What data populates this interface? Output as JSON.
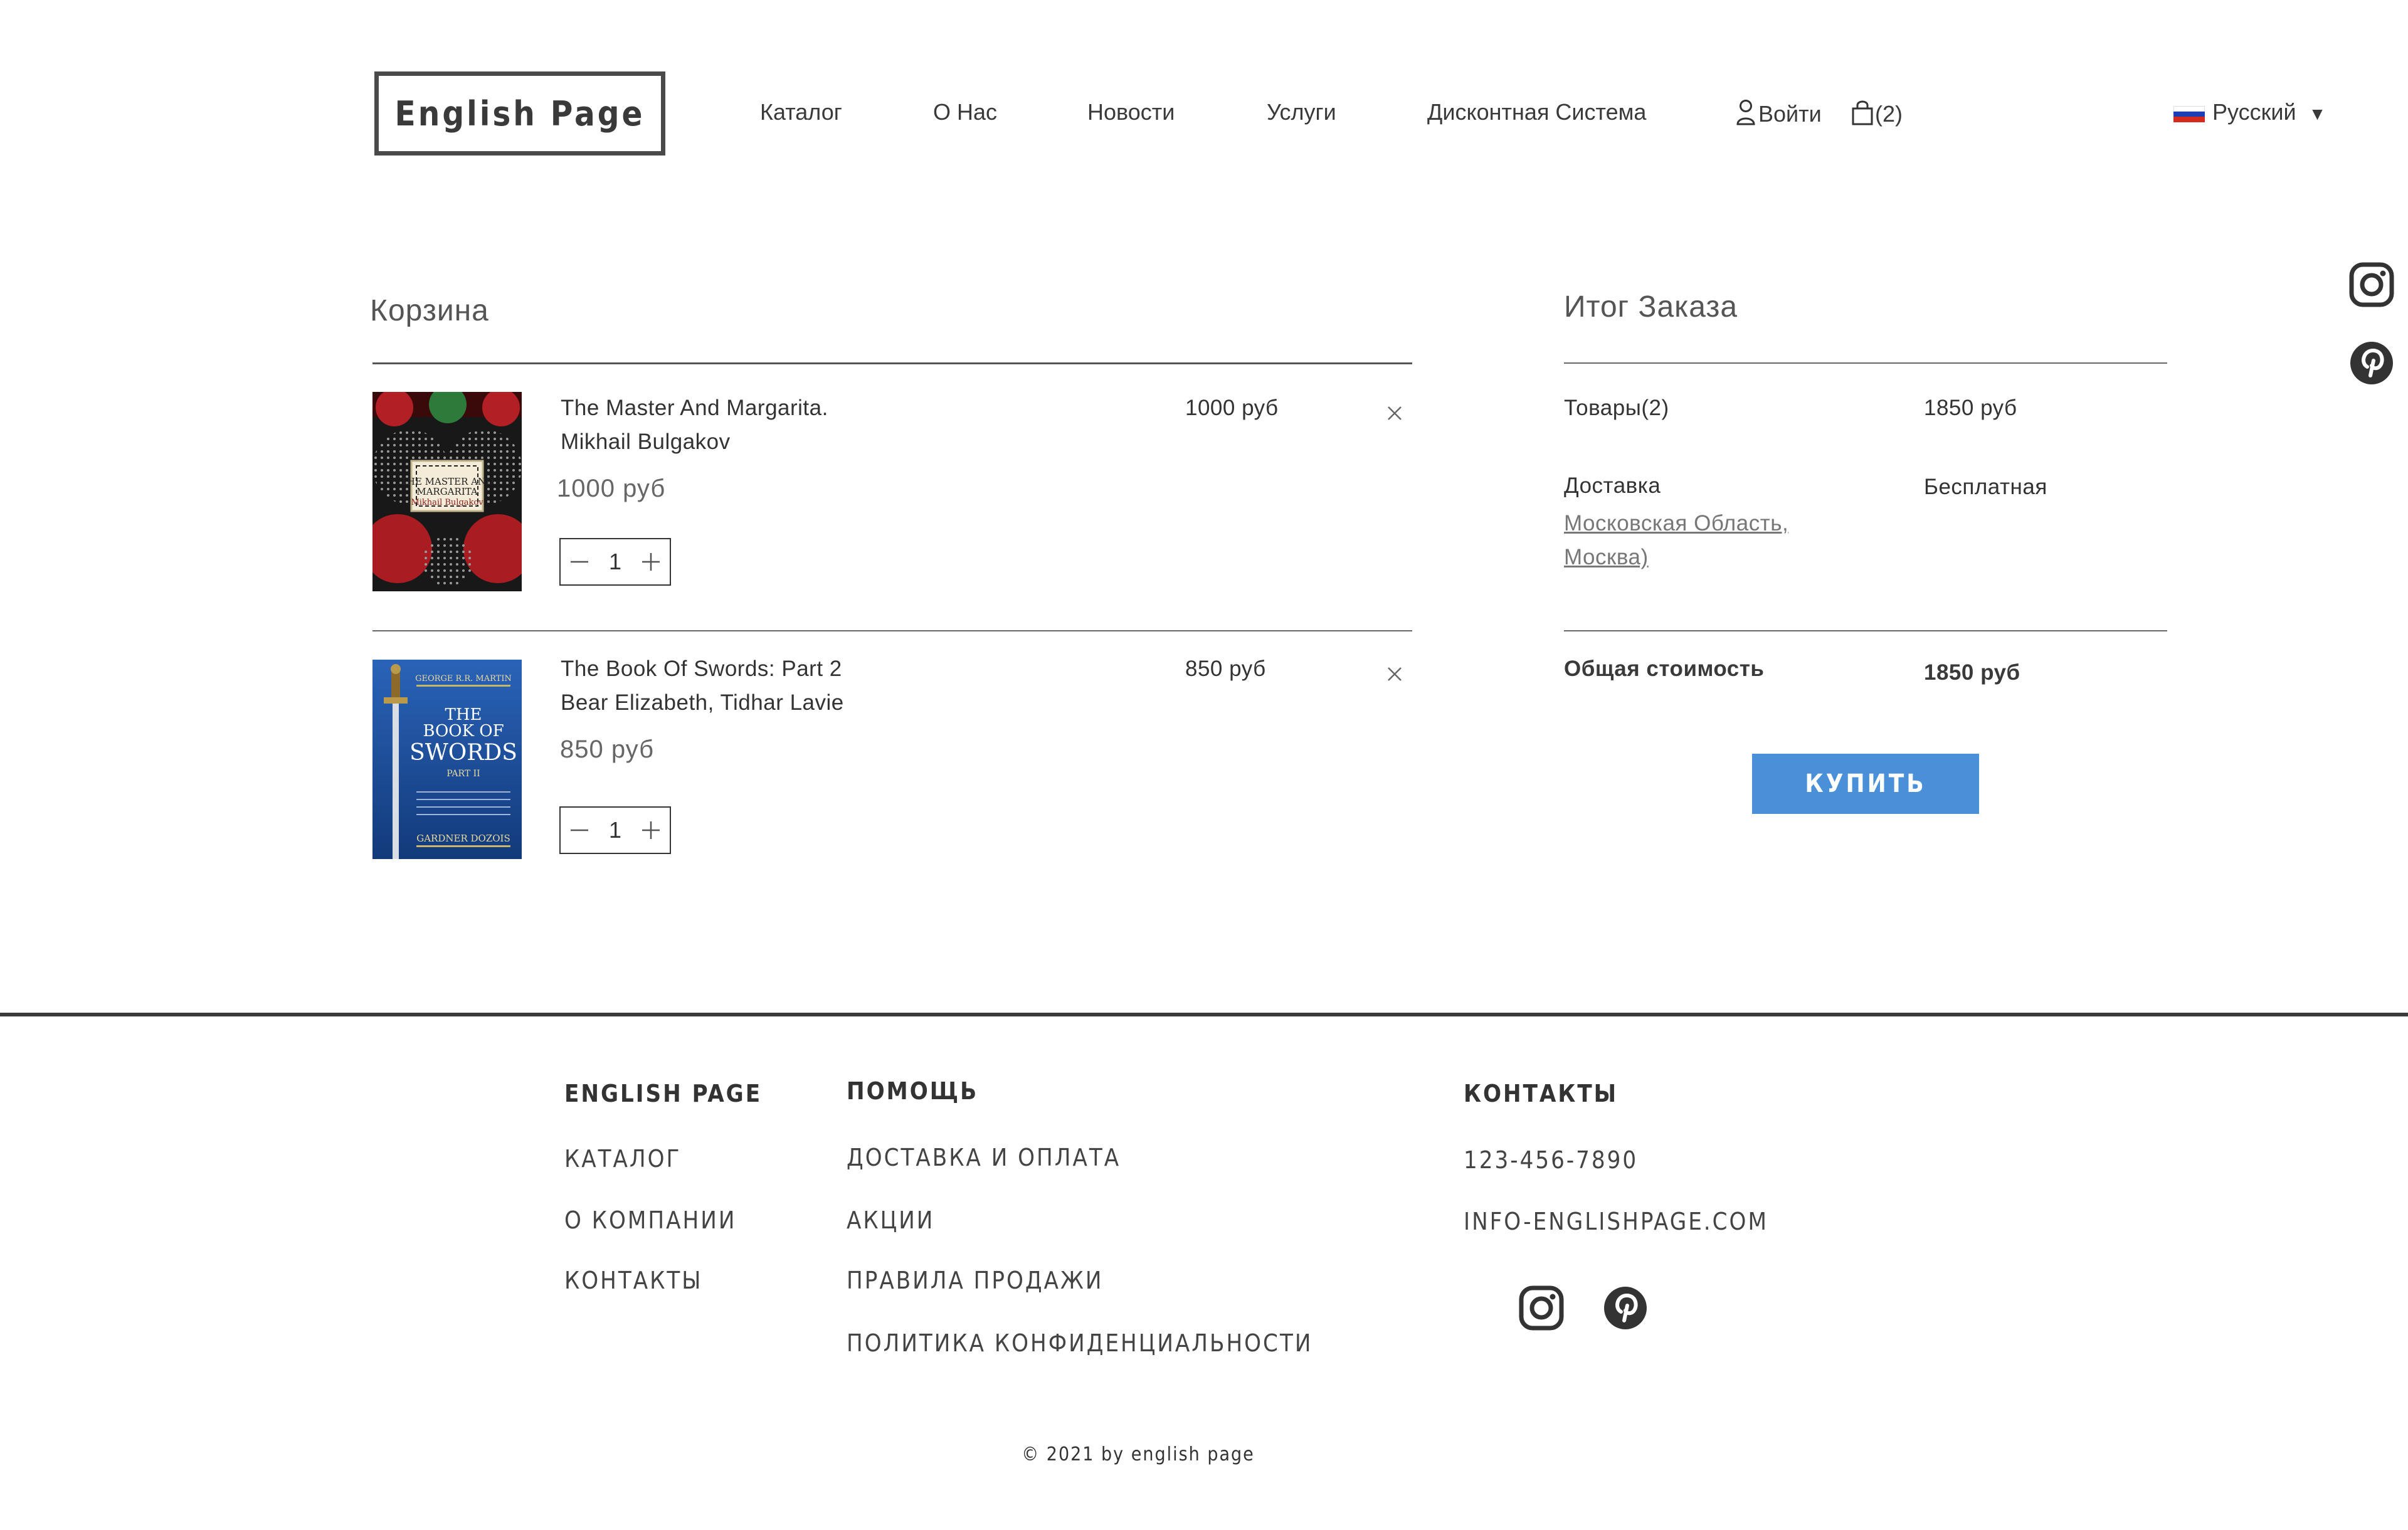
{
  "header": {
    "logo": "English Page",
    "nav": [
      "Каталог",
      "О Нас",
      "Новости",
      "Услуги",
      "Дисконтная Система"
    ],
    "login": "Войти",
    "cart_count": "(2)",
    "language": "Русский"
  },
  "cart": {
    "title": "Корзина",
    "items": [
      {
        "title_line1": "The Master And Margarita.",
        "title_line2": "Mikhail Bulgakov",
        "price_right": "1000 руб",
        "price": "1000 руб",
        "qty": "1",
        "cover_text": [
          "THE MASTER AND",
          "MARGARITA",
          "Mikhail Bulgakov"
        ]
      },
      {
        "title_line1": "The Book Of Swords: Part 2",
        "title_line2": "Bear Elizabeth, Tidhar Lavie",
        "price_right": "850 руб",
        "price": "850 руб",
        "qty": "1",
        "cover_text": [
          "GEORGE R.R. MARTIN",
          "THE",
          "BOOK OF",
          "SWORDS",
          "PART II",
          "GARDNER DOZOIS"
        ]
      }
    ]
  },
  "summary": {
    "title": "Итог Заказа",
    "items_label": "Товары(2)",
    "items_value": "1850 руб",
    "delivery_label": "Доставка",
    "delivery_value": "Бесплатная",
    "delivery_link_1": "Московская Область,",
    "delivery_link_2": "Москва)",
    "total_label": "Общая стоимость",
    "total_value": "1850 руб",
    "buy": "КУПИТЬ"
  },
  "footer": {
    "col1": {
      "title": "ENGLISH PAGE",
      "links": [
        "КАТАЛОГ",
        "О КОМПАНИИ",
        "КОНТАКТЫ"
      ]
    },
    "col2": {
      "title": "ПОМОЩЬ",
      "links": [
        "ДОСТАВКА И ОПЛАТА",
        "АКЦИИ",
        "ПРАВИЛА ПРОДАЖИ",
        "ПОЛИТИКА КОНФИДЕНЦИАЛЬНОСТИ"
      ]
    },
    "col3": {
      "title": "КОНТАКТЫ",
      "phone": "123-456-7890",
      "email": "INFO-ENGLISHPAGE.COM"
    },
    "copyright": "© 2021 by english page"
  },
  "icons": [
    "user-icon",
    "shopping-bag-icon",
    "russia-flag-icon",
    "dropdown-arrow-icon",
    "instagram-icon",
    "pinterest-icon",
    "close-icon",
    "minus-icon",
    "plus-icon"
  ],
  "colors": {
    "accent": "#4a90d9",
    "text": "#333333",
    "rule": "#555555"
  }
}
